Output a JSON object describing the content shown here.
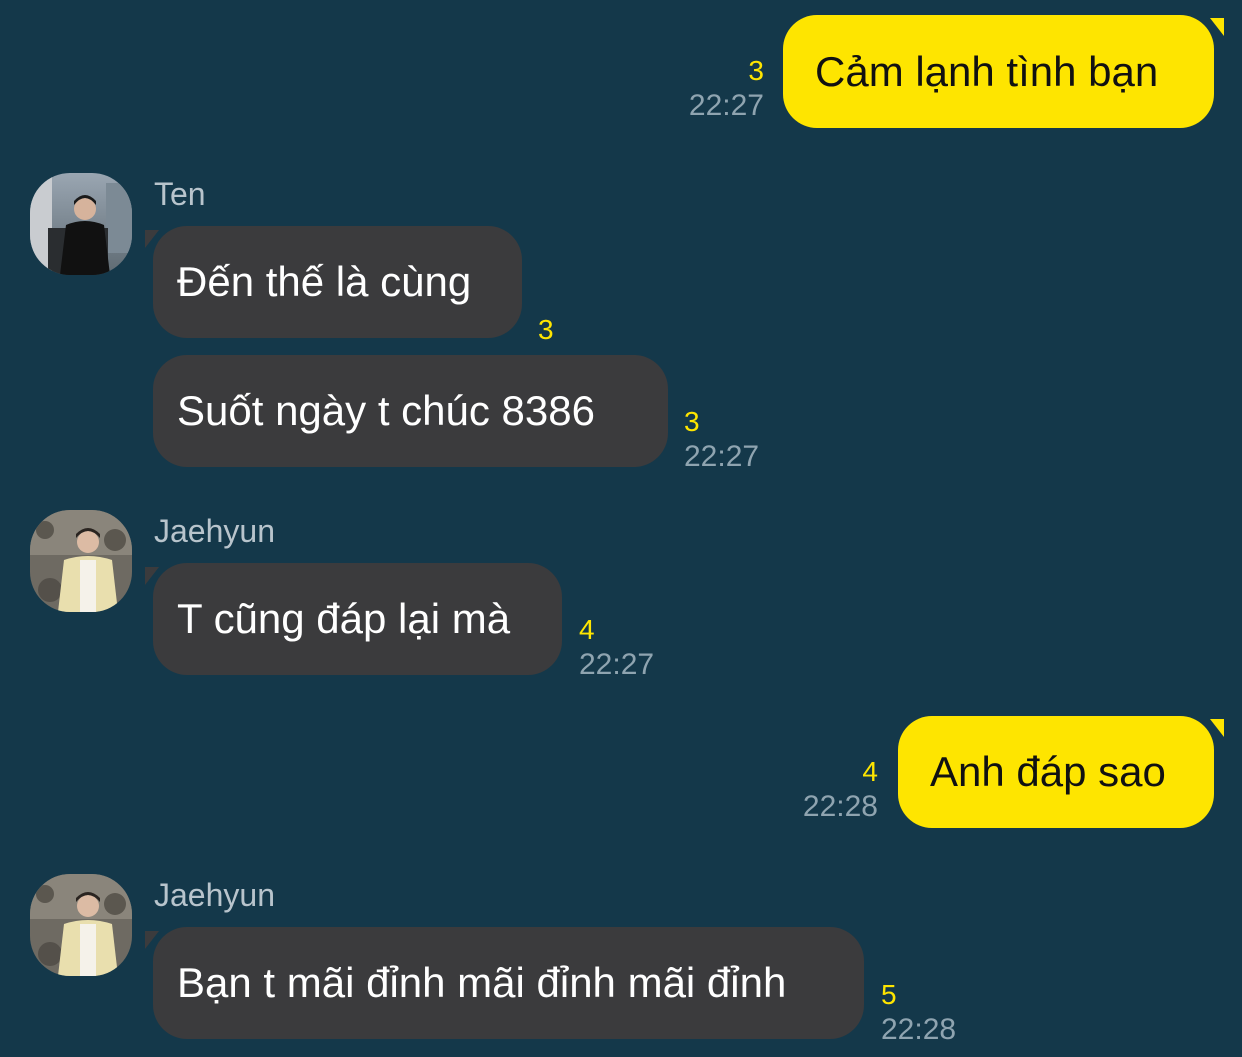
{
  "messages": [
    {
      "side": "mine",
      "text": "Cảm lạnh tình bạn",
      "unread": "3",
      "time": "22:27"
    },
    {
      "side": "theirs",
      "sender": "Ten",
      "text": "Đến thế là cùng",
      "unread": "3"
    },
    {
      "side": "theirs",
      "text": "Suốt ngày t chúc 8386",
      "unread": "3",
      "time": "22:27"
    },
    {
      "side": "theirs",
      "sender": "Jaehyun",
      "text": "T cũng đáp lại mà",
      "unread": "4",
      "time": "22:27"
    },
    {
      "side": "mine",
      "text": "Anh đáp sao",
      "unread": "4",
      "time": "22:28"
    },
    {
      "side": "theirs",
      "sender": "Jaehyun",
      "text": "Bạn t mãi đỉnh mãi đỉnh mãi đỉnh",
      "unread": "5",
      "time": "22:28"
    }
  ],
  "colors": {
    "background": "#14384a",
    "my_bubble": "#fee500",
    "their_bubble": "#3b3b3d",
    "unread_count": "#fee500",
    "timestamp": "#8fa4b0"
  }
}
